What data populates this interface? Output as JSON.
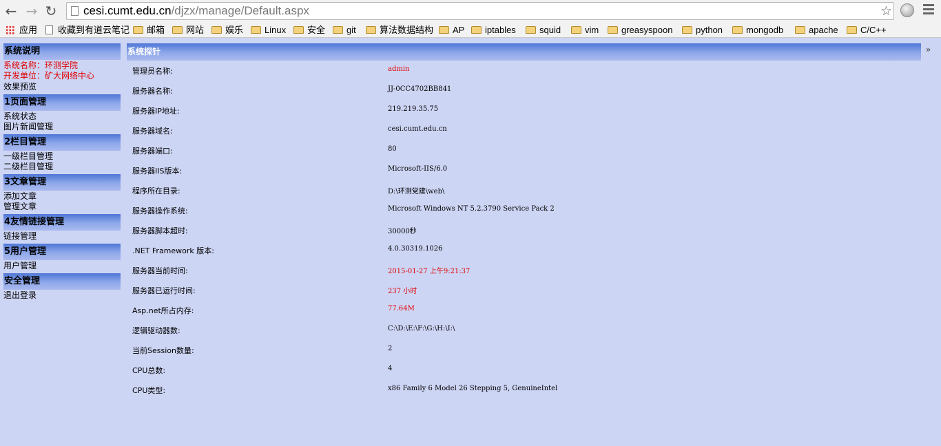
{
  "browser": {
    "url_host": "cesi.cumt.edu.cn",
    "url_path": "/djzx/manage/Default.aspx",
    "bookmarks": [
      "应用",
      "收藏到有道云笔记",
      "邮箱",
      "网站",
      "娱乐",
      "Linux",
      "安全",
      "git",
      "算法数据结构",
      "AP",
      "iptables",
      "squid",
      "vim",
      "greasyspoon",
      "python",
      "mongodb",
      "apache",
      "C/C++"
    ],
    "overflow": "»"
  },
  "sidebar": {
    "sections": [
      {
        "title": "系统说明",
        "items": []
      },
      {
        "title": "1页面管理",
        "items": [
          "系统状态",
          "图片新闻管理"
        ]
      },
      {
        "title": "2栏目管理",
        "items": [
          "一级栏目管理",
          "二级栏目管理"
        ]
      },
      {
        "title": "3文章管理",
        "items": [
          "添加文章",
          "管理文章"
        ]
      },
      {
        "title": "4友情链接管理",
        "items": [
          "链接管理"
        ]
      },
      {
        "title": "5用户管理",
        "items": [
          "用户管理"
        ]
      },
      {
        "title": "安全管理",
        "items": [
          "退出登录"
        ]
      }
    ],
    "system_name": "系统名称：环测学院",
    "developer": "开发单位：矿大网络中心",
    "preview": "效果预览"
  },
  "main": {
    "title": "系统探针",
    "rows": [
      {
        "label": "管理员名称:",
        "value": "admin",
        "red": true
      },
      {
        "label": "服务器名称:",
        "value": "JJ-0CC4702BB841",
        "red": false
      },
      {
        "label": "服务器IP地址:",
        "value": "219.219.35.75",
        "red": false
      },
      {
        "label": "服务器域名:",
        "value": "cesi.cumt.edu.cn",
        "red": false
      },
      {
        "label": "服务器端口:",
        "value": "80",
        "red": false
      },
      {
        "label": "服务器IIS版本:",
        "value": "Microsoft-IIS/6.0",
        "red": false
      },
      {
        "label": "程序所在目录:",
        "value": "D:\\环测党建\\web\\",
        "red": false
      },
      {
        "label": "服务器操作系统:",
        "value": "Microsoft Windows NT 5.2.3790 Service Pack 2",
        "red": false
      },
      {
        "label": "服务器脚本超时:",
        "value": "30000秒",
        "red": false
      },
      {
        "label": ".NET Framework 版本:",
        "value": "4.0.30319.1026",
        "red": false
      },
      {
        "label": "服务器当前时间:",
        "value": "2015-01-27 上午9:21:37",
        "red": true
      },
      {
        "label": "服务器已运行时间:",
        "value": "237 小时",
        "red": true
      },
      {
        "label": "Asp.net所占内存:",
        "value": "77.64M",
        "red": true
      },
      {
        "label": "逻辑驱动器数:",
        "value": "C:\\D:\\E:\\F:\\G:\\H:\\I:\\",
        "red": false
      },
      {
        "label": "当前Session数量:",
        "value": "2",
        "red": false
      },
      {
        "label": "CPU总数:",
        "value": "4",
        "red": false
      },
      {
        "label": "CPU类型:",
        "value": "x86 Family 6 Model 26 Stepping 5, GenuineIntel",
        "red": false
      }
    ]
  },
  "colors": {
    "page_bg": "#cdd5f4",
    "header_gradient_top": "#4f77d6",
    "value_red": "#e00000"
  }
}
